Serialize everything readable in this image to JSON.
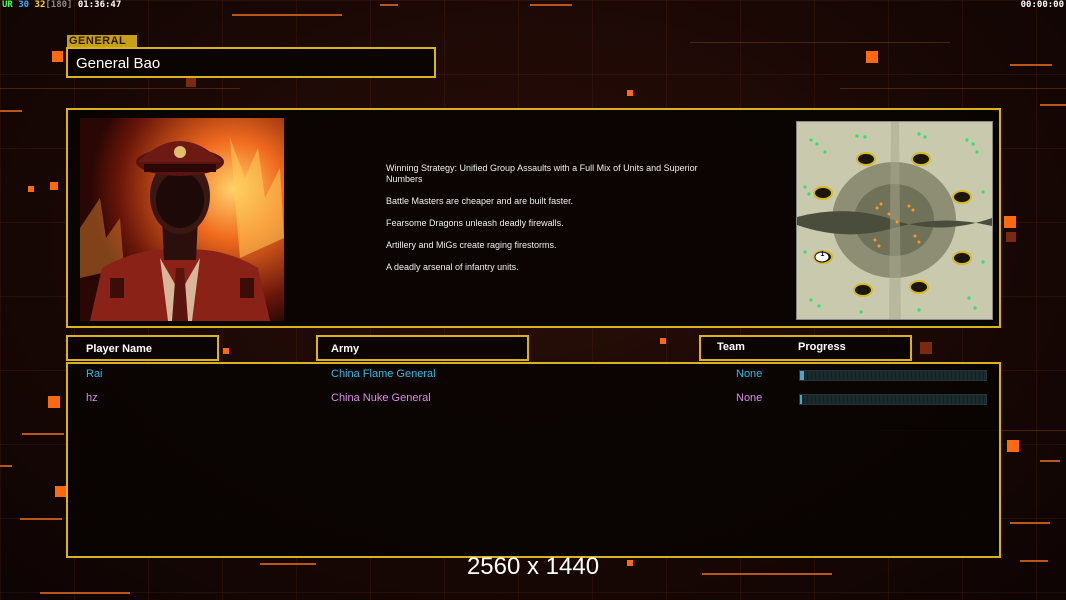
{
  "status": {
    "fps_label": "UR",
    "fps_value_a": "30",
    "fps_value_b": "32",
    "fps_cap": "[180]",
    "elapsed": "01:36:47",
    "timer": "00:00:00"
  },
  "general": {
    "tag": "GENERAL",
    "name": "General Bao",
    "strategy": [
      "Winning Strategy: Unified Group Assaults with a Full Mix of Units and Superior Numbers",
      "Battle Masters are cheaper and are built faster.",
      "Fearsome Dragons unleash deadly firewalls.",
      "Artillery and MiGs create raging firestorms.",
      "A deadly arsenal of infantry units."
    ]
  },
  "minimap": {
    "start_marker": "1"
  },
  "table": {
    "headers": {
      "player": "Player Name",
      "army": "Army",
      "team": "Team",
      "progress": "Progress"
    },
    "rows": [
      {
        "player": "Rai",
        "army": "China Flame General",
        "team": "None",
        "progress": 0.02,
        "color": "#35b9e6"
      },
      {
        "player": "hz",
        "army": "China Nuke General",
        "team": "None",
        "progress": 0.01,
        "color": "#d98ee6"
      }
    ]
  },
  "resolution": "2560 x 1440",
  "colors": {
    "frame": "#d8b41a",
    "accent": "#ff6a10"
  }
}
